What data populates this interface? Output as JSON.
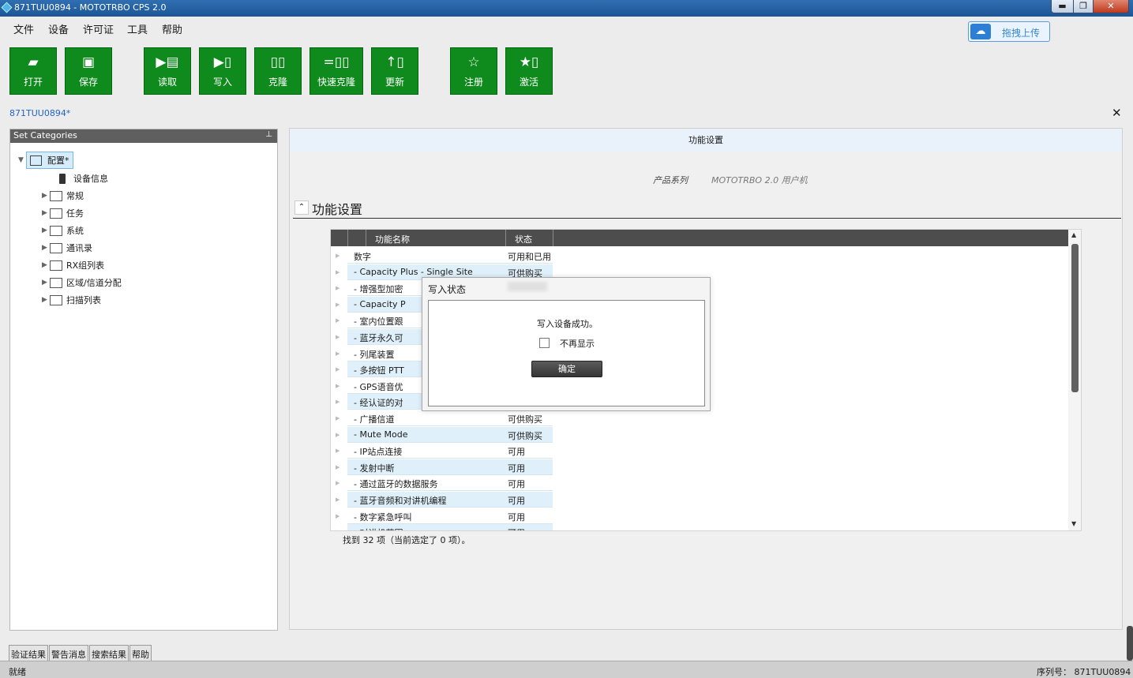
{
  "window": {
    "title": "871TUU0894 - MOTOTRBO CPS 2.0",
    "min": "▬",
    "max": "❐",
    "close": "✕"
  },
  "menu": [
    "文件",
    "设备",
    "许可证",
    "工具",
    "帮助"
  ],
  "upload_label": "拖拽上传",
  "toolbar": [
    {
      "label": "打开",
      "icon": "folder-open-icon",
      "glyph": "▰"
    },
    {
      "label": "保存",
      "icon": "save-icon",
      "glyph": "▣"
    },
    {
      "label": "读取",
      "icon": "read-icon",
      "glyph": "▶▤"
    },
    {
      "label": "写入",
      "icon": "write-icon",
      "glyph": "▶▯"
    },
    {
      "label": "克隆",
      "icon": "clone-icon",
      "glyph": "▯▯"
    },
    {
      "label": "快速克隆",
      "icon": "quick-clone-icon",
      "glyph": "=▯▯"
    },
    {
      "label": "更新",
      "icon": "update-icon",
      "glyph": "↑▯"
    },
    {
      "label": "注册",
      "icon": "register-star-icon",
      "glyph": "☆"
    },
    {
      "label": "激活",
      "icon": "activate-icon",
      "glyph": "★▯"
    }
  ],
  "doc_tab": "871TUU0894*",
  "doc_close": "✕",
  "left_panel": {
    "title": "Set Categories",
    "pin": "⊥",
    "root": "配置*",
    "child": "设备信息",
    "items": [
      "常规",
      "任务",
      "系统",
      "通讯录",
      "RX组列表",
      "区域/信道分配",
      "扫描列表"
    ]
  },
  "right_panel": {
    "header": "功能设置",
    "product_label": "产品系列",
    "product_value": "MOTOTRBO 2.0 用户机",
    "section_title": "功能设置"
  },
  "grid": {
    "columns": [
      "功能名称",
      "状态"
    ],
    "rows": [
      [
        "数字",
        "可用和已用"
      ],
      [
        "- Capacity Plus - Single Site",
        "可供购买"
      ],
      [
        "- 增强型加密",
        ""
      ],
      [
        "- Capacity P",
        ""
      ],
      [
        "- 室内位置跟",
        ""
      ],
      [
        "- 蓝牙永久可",
        ""
      ],
      [
        "- 列尾装置",
        ""
      ],
      [
        "- 多按钮 PTT",
        ""
      ],
      [
        "- GPS语音优",
        ""
      ],
      [
        "- 经认证的对",
        ""
      ],
      [
        "- 广播信道",
        "可供购买"
      ],
      [
        "- Mute Mode",
        "可供购买"
      ],
      [
        "- IP站点连接",
        "可用"
      ],
      [
        "- 发射中断",
        "可用"
      ],
      [
        "- 通过蓝牙的数据服务",
        "可用"
      ],
      [
        "- 蓝牙音频和对讲机编程",
        "可用"
      ],
      [
        "- 数字紧急呼叫",
        "可用"
      ],
      [
        "- 对讲机范围",
        "可用"
      ]
    ],
    "footer": "找到 32 项（当前选定了 0 项）。"
  },
  "dialog": {
    "title": "写入状态",
    "message": "写入设备成功。",
    "checkbox_label": "不再显示",
    "ok": "确定"
  },
  "bottom_tabs": [
    "验证结果",
    "警告消息",
    "搜索结果",
    "帮助"
  ],
  "status": {
    "left": "就绪",
    "right": "序列号：  871TUU0894"
  }
}
